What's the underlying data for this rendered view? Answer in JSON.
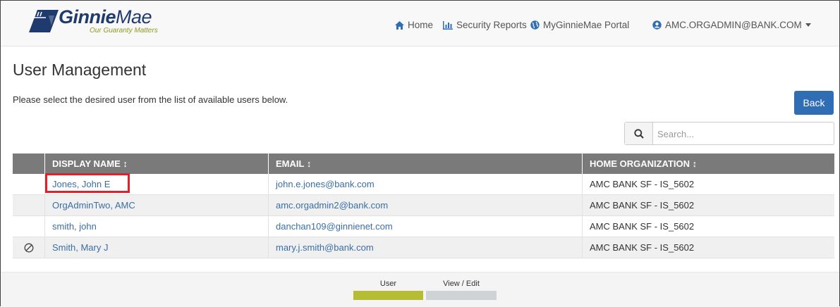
{
  "header": {
    "logo": {
      "name": "GinnieMae",
      "name_bold": "Ginnie",
      "name_light": "Mae",
      "tagline": "Our Guaranty Matters"
    },
    "nav": [
      {
        "label": "Home",
        "icon": "home-icon"
      },
      {
        "label": "Security Reports",
        "icon": "bar-chart-icon"
      },
      {
        "label": "MyGinnieMae Portal",
        "icon": "globe-icon"
      },
      {
        "label": "AMC.ORGADMIN@BANK.COM",
        "icon": "user-circle-icon",
        "dropdown_icon": "caret-down-icon"
      }
    ]
  },
  "main": {
    "title": "User Management",
    "instruction": "Please select the desired user from the list of available users below.",
    "back_label": "Back",
    "search": {
      "placeholder": "Search...",
      "value": "",
      "icon": "search-icon"
    },
    "table": {
      "columns": [
        "",
        "DISPLAY NAME ↕",
        "EMAIL ↕",
        "HOME ORGANIZATION ↕"
      ],
      "rows": [
        {
          "status_icon": "",
          "name": "Jones, John E",
          "email": "john.e.jones@bank.com",
          "org": "AMC BANK SF - IS_5602",
          "highlighted": true
        },
        {
          "status_icon": "",
          "name": "OrgAdminTwo, AMC",
          "email": "amc.orgadmin2@bank.com",
          "org": "AMC BANK SF - IS_5602"
        },
        {
          "status_icon": "",
          "name": "smith, john",
          "email": "danchan109@ginnienet.com",
          "org": "AMC BANK SF - IS_5602"
        },
        {
          "status_icon": "ban-icon",
          "name": "Smith, Mary J",
          "email": "mary.j.smith@bank.com",
          "org": "AMC BANK SF - IS_5602"
        }
      ]
    }
  },
  "footer": {
    "legend": [
      {
        "label": "User",
        "color": "#b5bd35"
      },
      {
        "label": "View / Edit",
        "color": "#cfd3d6"
      }
    ]
  },
  "colors": {
    "brand_blue": "#1f3a6e",
    "brand_green": "#8c9a1e",
    "button_blue": "#2f6eb5",
    "header_gray": "#7a7a7a",
    "link_blue": "#3a6ea5",
    "highlight_red": "#e0202a"
  }
}
